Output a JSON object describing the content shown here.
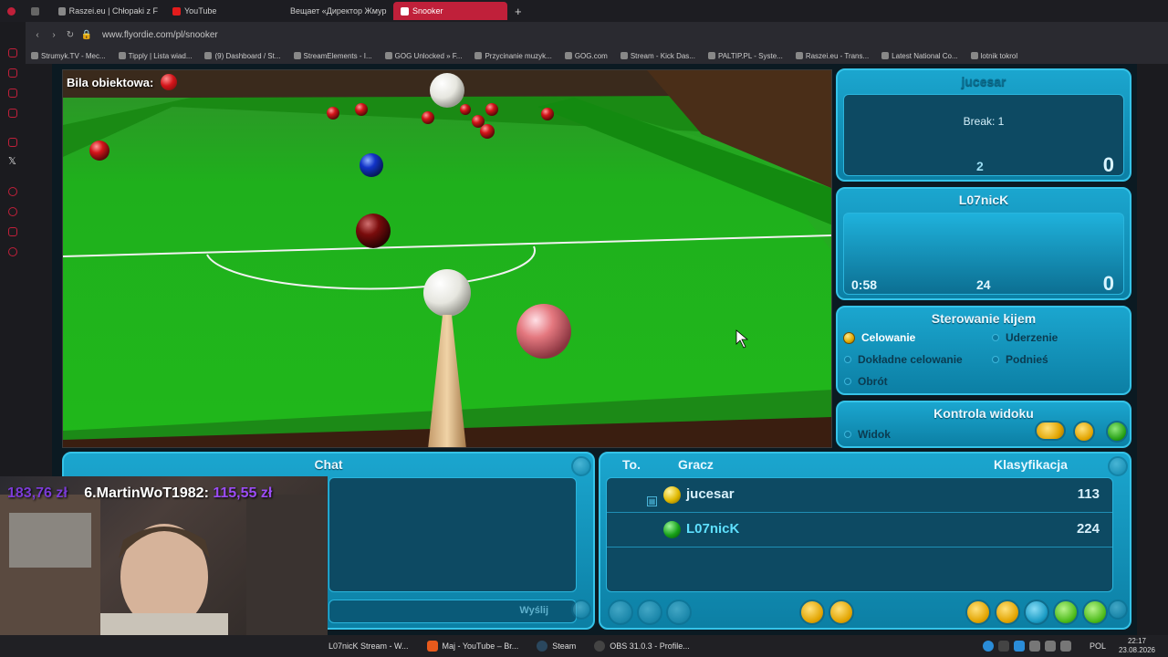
{
  "browser": {
    "tabs": [
      {
        "label": "Raszei.eu | Chłopaki z F",
        "color": "#888"
      },
      {
        "label": "YouTube",
        "color": "#e31c1c"
      },
      {
        "label": "Вещает «Директор Жмур",
        "color": "#e31c1c"
      },
      {
        "label": "Snooker",
        "color": "#e31c1c",
        "active": true
      }
    ],
    "url": "www.flyordie.com/pl/snooker",
    "bookmarks": [
      "Strumyk.TV - Mec...",
      "Tipply | Lista wiad...",
      "(9) Dashboard / St...",
      "StreamElements - I...",
      "GOG Unlocked » F...",
      "Przycinanie muzyk...",
      "GOG.com",
      "Stream - Kick Das...",
      "PALTIP.PL - Syste...",
      "Raszei.eu - Trans...",
      "Latest National Co...",
      "lotnik tokrol"
    ]
  },
  "game": {
    "object_ball_label": "Bila obiektowa:",
    "player1": {
      "name": "jucesar",
      "break_text": "Break: 1",
      "break_num": "2",
      "score": "0"
    },
    "player2": {
      "name": "L07nicK",
      "timer": "0:58",
      "break_num": "24",
      "score": "0"
    },
    "cue_control": {
      "title": "Sterowanie kijem",
      "options": [
        "Celowanie",
        "Uderzenie",
        "Dokładne celowanie",
        "Podnieś",
        "Obrót"
      ],
      "selected": "Celowanie"
    },
    "view_control": {
      "title": "Kontrola widoku",
      "option": "Widok"
    },
    "chat": {
      "title": "Chat",
      "send_label": "Wyślij"
    },
    "ranking": {
      "col_turn": "To.",
      "col_player": "Gracz",
      "col_rank": "Klasyfikacja",
      "rows": [
        {
          "name": "jucesar",
          "rating": "113",
          "ball": "yellow"
        },
        {
          "name": "L07nicK",
          "rating": "224",
          "ball": "green"
        }
      ]
    }
  },
  "overlay": {
    "donation_amount": "183,76 zł",
    "donation_text": "6.MartinWoT1982:",
    "donation_value": "115,55 zł"
  },
  "taskbar": {
    "items": [
      {
        "label": "L07nicK Stream - W...",
        "color": "#888"
      },
      {
        "label": "Maj - YouTube – Br...",
        "color": "#e85a1c"
      },
      {
        "label": "Steam",
        "color": "#1b2838"
      },
      {
        "label": "OBS 31.0.3 - Profile...",
        "color": "#333"
      }
    ],
    "lang": "POL",
    "time": "22:17",
    "date": "23.08.2026"
  },
  "colors": {
    "accent": "#c0203a",
    "panel": "#1ba6cf",
    "table": "#20b81b"
  }
}
